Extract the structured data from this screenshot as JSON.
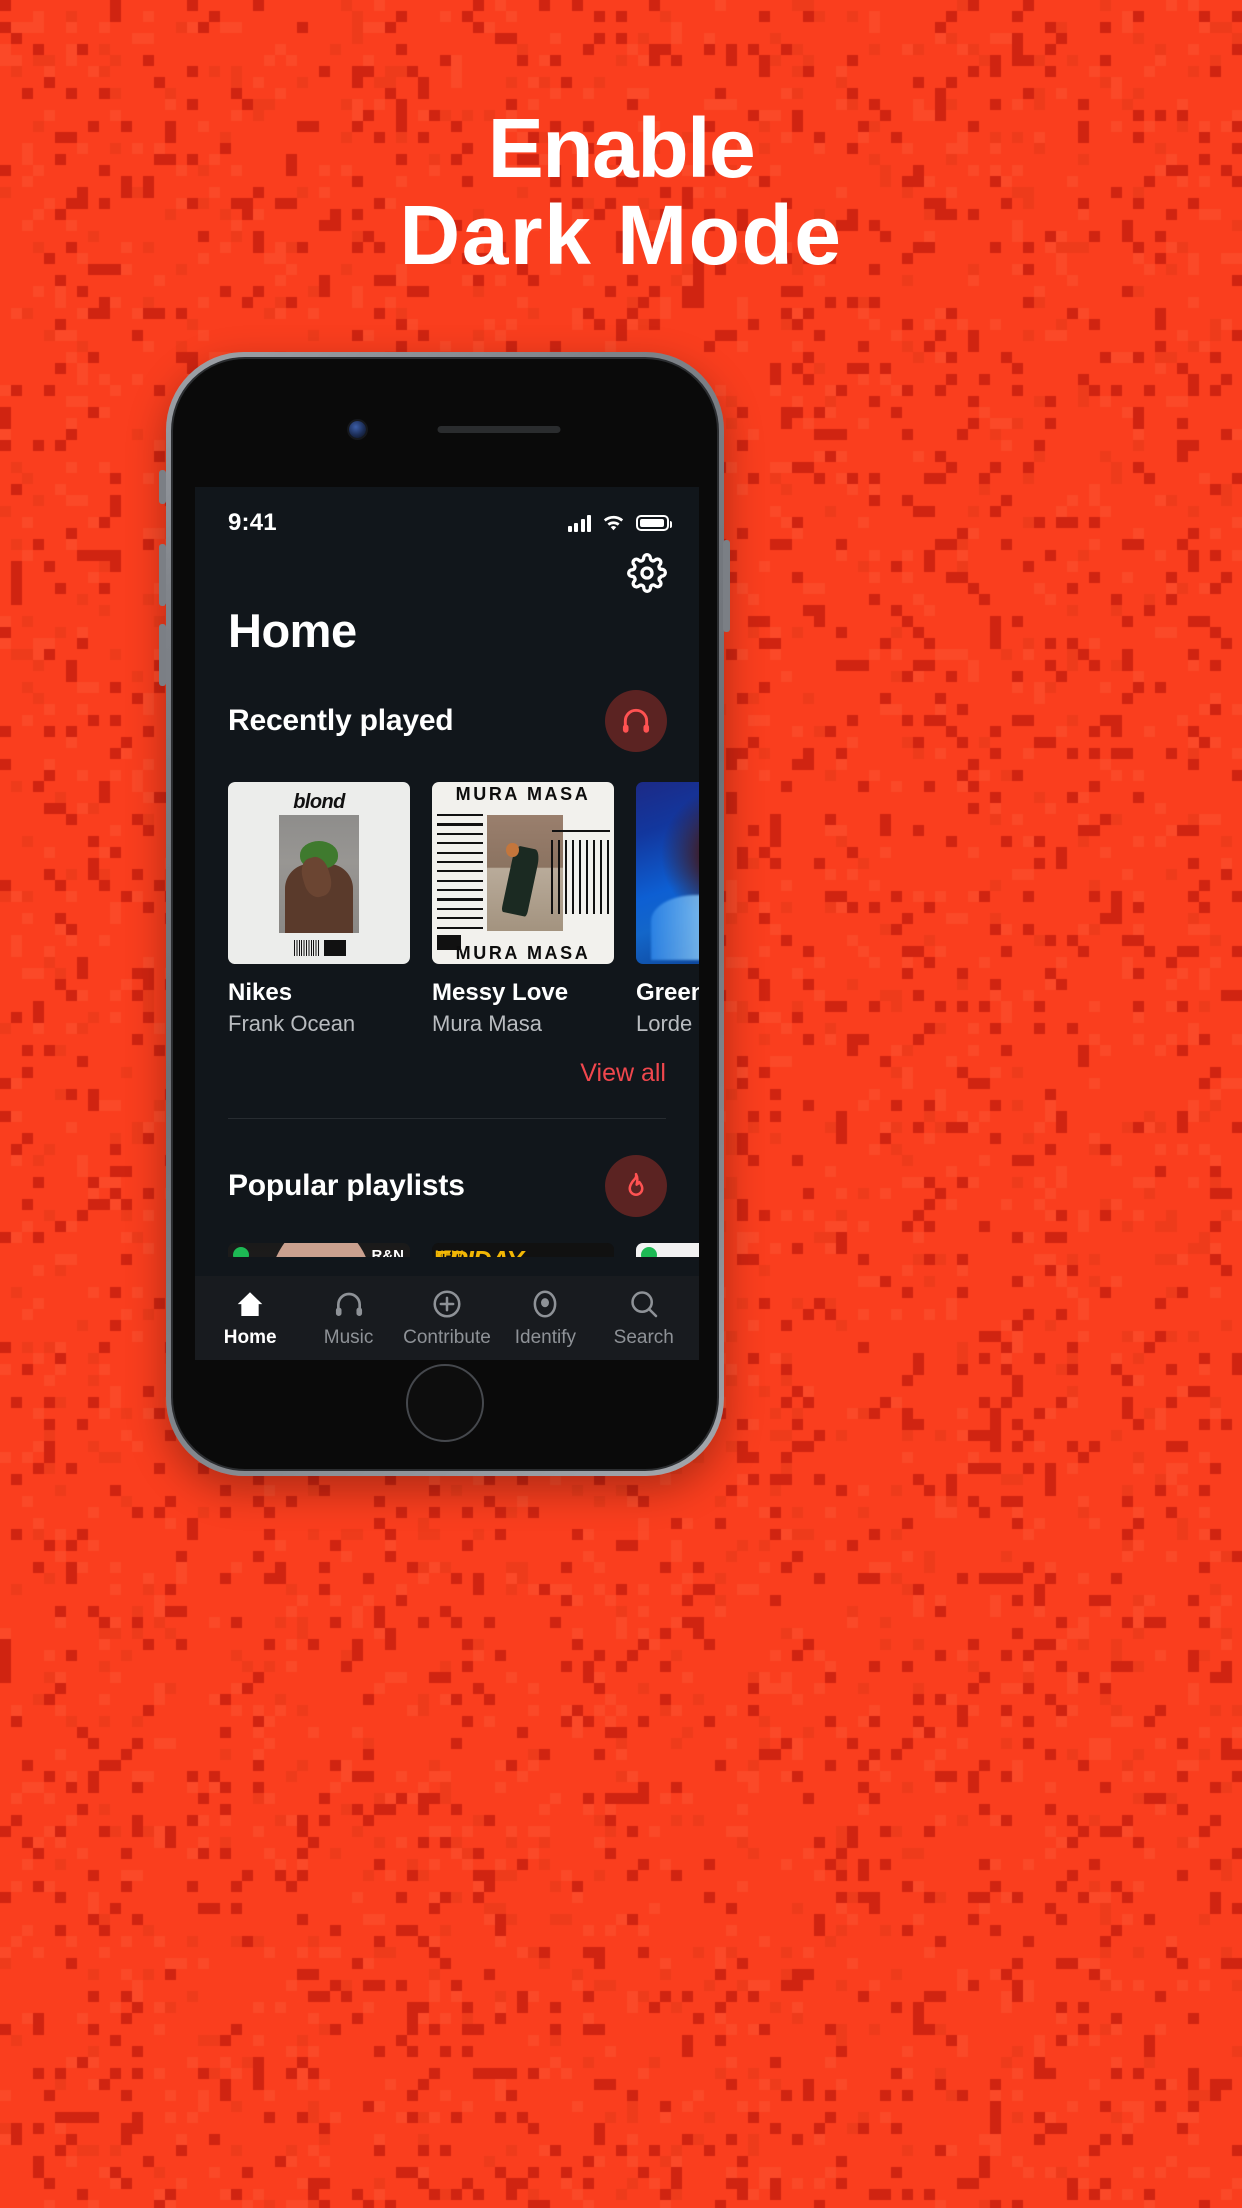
{
  "poster": {
    "background_color": "#FA3E1E",
    "headline_line1": "Enable",
    "headline_line2": "Dark Mode"
  },
  "phone": {
    "status_bar": {
      "time": "9:41",
      "signal_icon": "cellular-signal-icon",
      "wifi_icon": "wifi-icon",
      "battery_icon": "battery-icon"
    },
    "header": {
      "settings_icon": "gear-icon",
      "page_title": "Home"
    },
    "sections": [
      {
        "title": "Recently played",
        "badge_icon": "headphones-icon",
        "badge_bg": "#5b2322",
        "badge_fg": "#ff5252",
        "cards": [
          {
            "title": "Nikes",
            "subtitle": "Frank Ocean",
            "art": "blonde-album-art"
          },
          {
            "title": "Messy Love",
            "subtitle": "Mura Masa",
            "art": "mura-masa-album-art"
          },
          {
            "title": "Green",
            "subtitle": "Lorde",
            "art": "melodrama-album-art"
          }
        ],
        "view_all_label": "View all",
        "view_all_color": "#f0474d"
      },
      {
        "title": "Popular playlists",
        "badge_icon": "flame-icon",
        "badge_bg": "#5b2322",
        "badge_fg": "#ff5252",
        "cards": [
          {
            "art": "playlist-art-1"
          },
          {
            "art": "playlist-art-2",
            "label": "NEW",
            "label2": "FRIDAY"
          },
          {
            "art": "playlist-art-3"
          }
        ]
      }
    ],
    "album_art_text": {
      "blonde_word": "blond",
      "mura_top": "MURA MASA",
      "mura_bottom": "MURA MASA"
    },
    "tabbar": [
      {
        "label": "Home",
        "icon": "home-icon",
        "active": true
      },
      {
        "label": "Music",
        "icon": "headphones-icon",
        "active": false
      },
      {
        "label": "Contribute",
        "icon": "plus-circle-icon",
        "active": false
      },
      {
        "label": "Identify",
        "icon": "record-icon",
        "active": false
      },
      {
        "label": "Search",
        "icon": "search-icon",
        "active": false
      }
    ]
  }
}
